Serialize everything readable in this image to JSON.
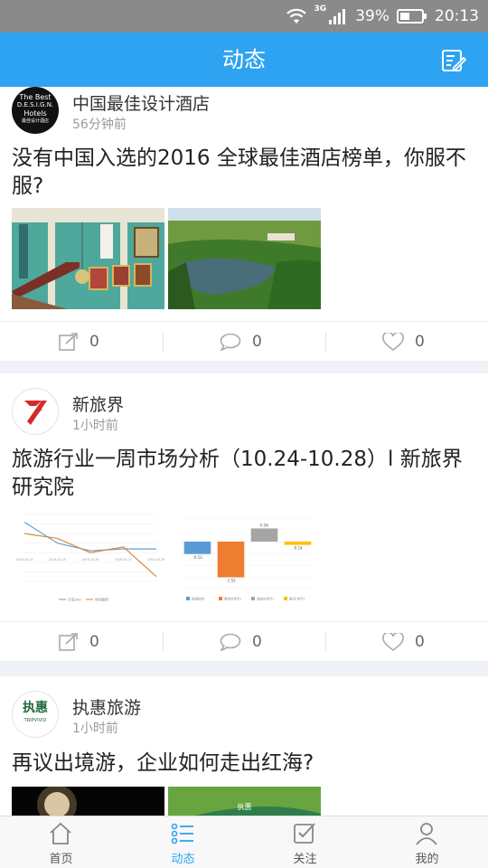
{
  "status_bar": {
    "network": "3G",
    "battery": "39%",
    "time": "20:13"
  },
  "header": {
    "title": "动态"
  },
  "posts": [
    {
      "author": "中国最佳设计酒店",
      "time": "56分钟前",
      "avatar_text": [
        "The Best",
        "D.E.S.I.G.N.",
        "Hotels",
        "最佳设计酒店"
      ],
      "title": "没有中国入选的2016 全球最佳酒店榜单，你服不服?",
      "share_count": "0",
      "comment_count": "0",
      "like_count": "0"
    },
    {
      "author": "新旅界",
      "time": "1小时前",
      "title": "旅游行业一周市场分析（10.24-10.28）l 新旅界研究院",
      "share_count": "0",
      "comment_count": "0",
      "like_count": "0"
    },
    {
      "author": "执惠旅游",
      "time": "1小时前",
      "avatar_text": [
        "执惠",
        "TRIPVIVID"
      ],
      "title": "再议出境游，企业如何走出红海?",
      "image_logo": "执惠"
    }
  ],
  "chart_line": {
    "type": "line",
    "categories": [
      "2016-10-24",
      "2016-10-25",
      "2016-10-26",
      "2016-10-27",
      "2016-10-28"
    ],
    "series": [
      {
        "name": "沪深300",
        "color": "#6a9fd0",
        "values": [
          3.2,
          1.0,
          0.2,
          0.4,
          0.4
        ]
      },
      {
        "name": "休闲服务",
        "color": "#d08a3e",
        "values": [
          2.0,
          1.5,
          0.0,
          0.6,
          -2.5
        ]
      }
    ]
  },
  "chart_bar": {
    "type": "bar",
    "categories": [
      "旅游综合",
      "餐饮Ⅱ(申万)",
      "酒店Ⅱ(申万)",
      "景点(申万)"
    ],
    "values": [
      -0.53,
      -1.52,
      0.56,
      -0.14
    ],
    "labels": [
      "-0.53",
      "-1.52",
      "0.56",
      "-0.14"
    ],
    "colors": [
      "#5b9bd5",
      "#ed7d31",
      "#a5a5a5",
      "#ffc000"
    ]
  },
  "tabs": [
    {
      "label": "首页",
      "icon": "home-icon"
    },
    {
      "label": "动态",
      "icon": "feed-list-icon",
      "active": true
    },
    {
      "label": "关注",
      "icon": "follow-check-icon"
    },
    {
      "label": "我的",
      "icon": "profile-icon"
    }
  ],
  "colors": {
    "primary": "#2ea3f2",
    "status_bar": "#8a8a8a"
  }
}
